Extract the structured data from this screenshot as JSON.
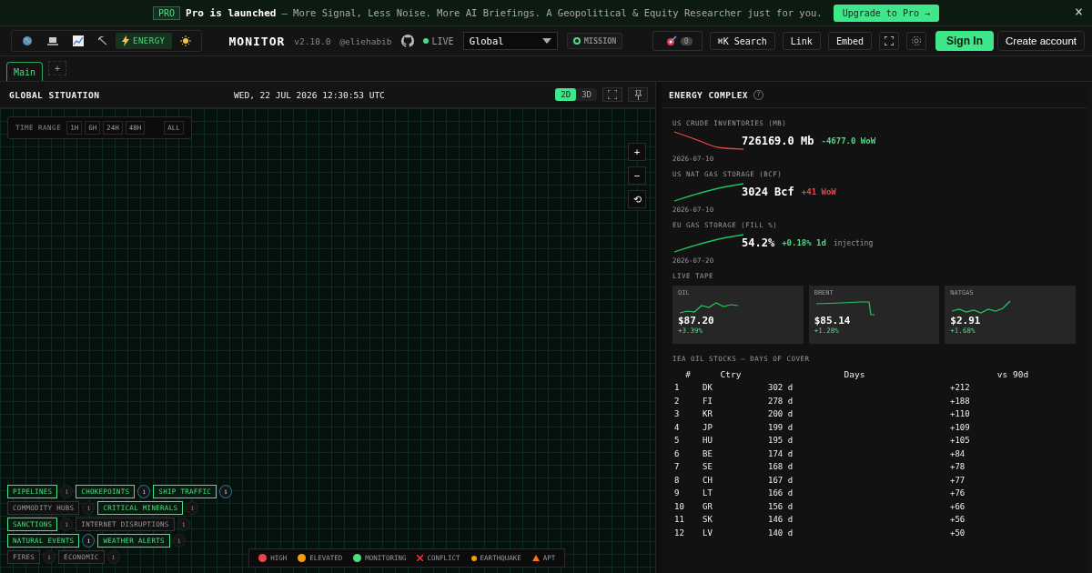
{
  "banner": {
    "badge": "PRO",
    "title": "Pro is launched",
    "message": "— More Signal, Less Noise. More AI Briefings. A Geopolitical & Equity Researcher just for you.",
    "cta": "Upgrade to Pro →",
    "close": "×"
  },
  "header": {
    "variants": [
      {
        "kind": "globe",
        "selected": false
      },
      {
        "kind": "laptop",
        "selected": false
      },
      {
        "kind": "chart",
        "selected": false
      },
      {
        "kind": "pick",
        "selected": false
      },
      {
        "kind": "energy",
        "label": "ENERGY",
        "selected": true
      },
      {
        "kind": "sun",
        "selected": false
      }
    ],
    "brand": "MONITOR",
    "version": "v2.10.0",
    "handle": "@eliehabib",
    "live": "LIVE",
    "region": "Global",
    "mission": "MISSION",
    "alerts_count": "0",
    "search": "⌘K  Search",
    "link": "Link",
    "embed": "Embed",
    "sign_in": "Sign In",
    "create_account": "Create account"
  },
  "tabs": [
    {
      "label": "Main",
      "selected": true
    }
  ],
  "add_tab": "+",
  "map_panel": {
    "title": "GLOBAL SITUATION",
    "clock": "WED, 22 JUL 2026 12:30:53 UTC",
    "views": [
      {
        "label": "2D",
        "selected": true
      },
      {
        "label": "3D",
        "selected": false
      }
    ],
    "time_range": {
      "label": "TIME RANGE",
      "options": [
        {
          "label": "1H",
          "selected": false
        },
        {
          "label": "6H",
          "selected": false
        },
        {
          "label": "24H",
          "selected": false
        },
        {
          "label": "48H",
          "selected": false
        },
        {
          "label": "ALL",
          "selected": false
        }
      ]
    },
    "zoom_in": "+",
    "zoom_out": "−",
    "reset": "⟲",
    "layers": [
      [
        {
          "label": "PIPELINES",
          "on": true,
          "info": "i",
          "info_active": false
        },
        {
          "label": "CHOKEPOINTS",
          "on": true,
          "info": "i",
          "info_active": true
        },
        {
          "label": "SHIP TRAFFIC",
          "on": true,
          "info": "i",
          "info_active": true
        }
      ],
      [
        {
          "label": "COMMODITY HUBS",
          "on": false,
          "info": "i",
          "info_active": false
        },
        {
          "label": "CRITICAL MINERALS",
          "on": true,
          "info": "i",
          "info_active": false
        }
      ],
      [
        {
          "label": "SANCTIONS",
          "on": true,
          "info": "i",
          "info_active": false
        },
        {
          "label": "INTERNET DISRUPTIONS",
          "on": false,
          "info": "i",
          "info_active": false
        }
      ],
      [
        {
          "label": "NATURAL EVENTS",
          "on": true,
          "info": "i",
          "info_active": true
        },
        {
          "label": "WEATHER ALERTS",
          "on": true,
          "info": "i",
          "info_active": false
        }
      ],
      [
        {
          "label": "FIRES",
          "on": false,
          "info": "i",
          "info_active": false
        },
        {
          "label": "ECONOMIC",
          "on": false,
          "info": "i",
          "info_active": false
        }
      ]
    ],
    "legend": [
      {
        "label": "HIGH",
        "kind": "dot",
        "color": "#ef4444"
      },
      {
        "label": "ELEVATED",
        "kind": "dot",
        "color": "#f59e0b"
      },
      {
        "label": "MONITORING",
        "kind": "dot",
        "color": "#4ade80"
      },
      {
        "label": "CONFLICT",
        "kind": "cross",
        "color": "#ef4444"
      },
      {
        "label": "EARTHQUAKE",
        "kind": "small-dot",
        "color": "#f59e0b"
      },
      {
        "label": "APT",
        "kind": "triangle",
        "color": "#f97316"
      }
    ]
  },
  "energy_panel": {
    "title": "ENERGY COMPLEX",
    "help": "?",
    "metrics": [
      {
        "label": "US CRUDE INVENTORIES (MB)",
        "kind": "falling",
        "value": "726169.0 Mb",
        "change": "-4677.0 WoW",
        "color": "#4ade80",
        "date": "2026-07-10"
      },
      {
        "label": "US NAT GAS STORAGE (BCF)",
        "kind": "rising",
        "value": "3024 Bcf",
        "change": "+41 WoW",
        "color": "#ef4444",
        "date": "2026-07-10"
      },
      {
        "label": "EU GAS STORAGE (FILL %)",
        "kind": "rising",
        "value": "54.2%",
        "change": "+0.18% 1d",
        "color": "#4ade80",
        "note": "injecting",
        "date": "2026-07-20"
      }
    ],
    "tape_title": "LIVE TAPE",
    "tape": [
      {
        "name": "OIL",
        "price": "$87.20",
        "change": "+3.39%"
      },
      {
        "name": "BRENT",
        "price": "$85.14",
        "change": "+1.28%"
      },
      {
        "name": "NATGAS",
        "price": "$2.91",
        "change": "+1.68%"
      }
    ],
    "stocks_title": "IEA OIL STOCKS – DAYS OF COVER",
    "columns": [
      "#",
      "Ctry",
      "Days",
      "vs 90d"
    ],
    "rows": [
      [
        "1",
        "DK",
        "302 d",
        "+212"
      ],
      [
        "2",
        "FI",
        "278 d",
        "+188"
      ],
      [
        "3",
        "KR",
        "200 d",
        "+110"
      ],
      [
        "4",
        "JP",
        "199 d",
        "+109"
      ],
      [
        "5",
        "HU",
        "195 d",
        "+105"
      ],
      [
        "6",
        "BE",
        "174 d",
        "+84"
      ],
      [
        "7",
        "SE",
        "168 d",
        "+78"
      ],
      [
        "8",
        "CH",
        "167 d",
        "+77"
      ],
      [
        "9",
        "LT",
        "166 d",
        "+76"
      ],
      [
        "10",
        "GR",
        "156 d",
        "+66"
      ],
      [
        "11",
        "SK",
        "146 d",
        "+56"
      ],
      [
        "12",
        "LV",
        "140 d",
        "+50"
      ]
    ]
  }
}
